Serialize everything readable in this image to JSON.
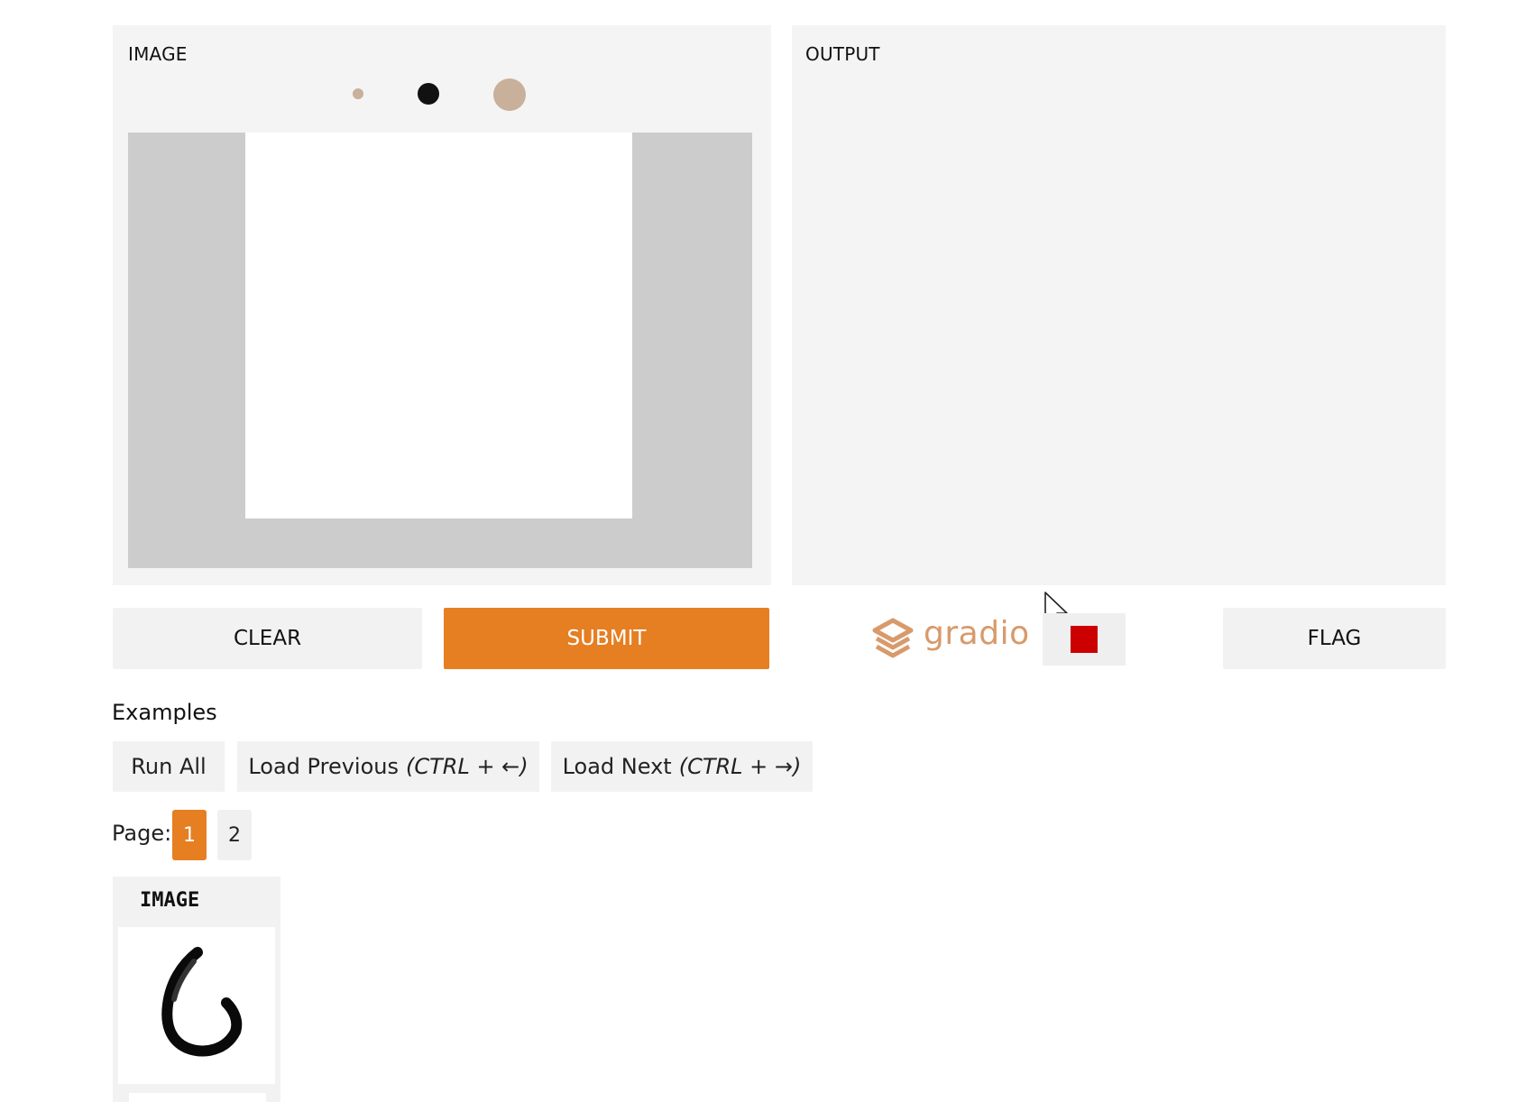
{
  "input_panel": {
    "label": "IMAGE",
    "brushes": [
      {
        "name": "small",
        "color": "#c8b09a"
      },
      {
        "name": "medium",
        "color": "#111111"
      },
      {
        "name": "large",
        "color": "#c8b09a"
      }
    ]
  },
  "output_panel": {
    "label": "OUTPUT"
  },
  "actions": {
    "clear_label": "CLEAR",
    "submit_label": "SUBMIT",
    "flag_label": "FLAG",
    "accent_color": "#e67e22"
  },
  "branding": {
    "logo_text": "gradio",
    "stop_color": "#cc0000"
  },
  "examples": {
    "heading": "Examples",
    "run_all_label": "Run All",
    "load_previous_label": "Load Previous",
    "load_previous_hint": "(CTRL + ←)",
    "load_next_label": "Load Next",
    "load_next_hint": "(CTRL + →)",
    "page_label": "Page:",
    "pages": [
      "1",
      "2"
    ],
    "active_page": "1",
    "table_header": "IMAGE"
  }
}
